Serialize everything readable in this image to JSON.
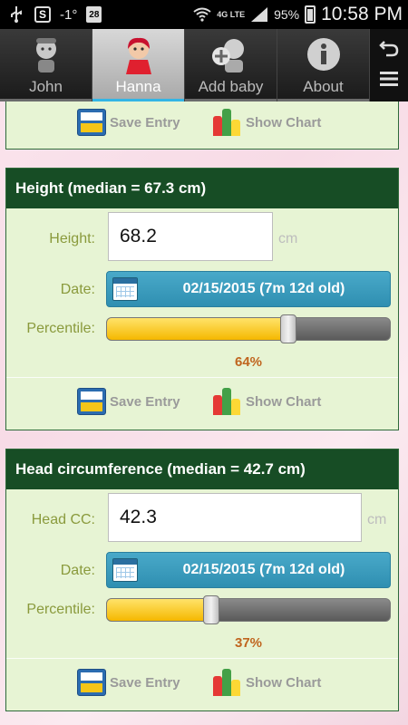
{
  "status_bar": {
    "temperature": "-1°",
    "calendar_day": "28",
    "network": "4G LTE",
    "battery": "95%",
    "time": "10:58 PM",
    "icons": [
      "usb-icon",
      "s-app-icon",
      "calendar-icon",
      "wifi-icon",
      "signal-icon",
      "battery-icon"
    ]
  },
  "tabs": [
    {
      "label": "John",
      "icon": "boy-icon",
      "active": false
    },
    {
      "label": "Hanna",
      "icon": "girl-icon",
      "active": true
    },
    {
      "label": "Add baby",
      "icon": "add-baby-icon",
      "active": false
    },
    {
      "label": "About",
      "icon": "info-icon",
      "active": false
    }
  ],
  "top_actions": {
    "save_label": "Save Entry",
    "chart_label": "Show Chart"
  },
  "height_card": {
    "title": "Height (median = 67.3 cm)",
    "field_label": "Height:",
    "value": "68.2",
    "unit": "cm",
    "date_label": "Date:",
    "date_value": "02/15/2015 (7m 12d old)",
    "percentile_label": "Percentile:",
    "percentile_text": "64%",
    "percentile": 0.64,
    "save_label": "Save Entry",
    "chart_label": "Show Chart"
  },
  "head_card": {
    "title": "Head circumference (median = 42.7 cm)",
    "field_label": "Head CC:",
    "value": "42.3",
    "unit": "cm",
    "date_label": "Date:",
    "date_value": "02/15/2015 (7m 12d old)",
    "percentile_label": "Percentile:",
    "percentile_text": "37%",
    "percentile": 0.37,
    "save_label": "Save Entry",
    "chart_label": "Show Chart"
  },
  "colors": {
    "header_green": "#174d25",
    "card_bg": "#e7f4d4",
    "accent_blue": "#33b5e5",
    "percent_orange": "#c0651f",
    "slider_yellow": "#f5b800"
  }
}
